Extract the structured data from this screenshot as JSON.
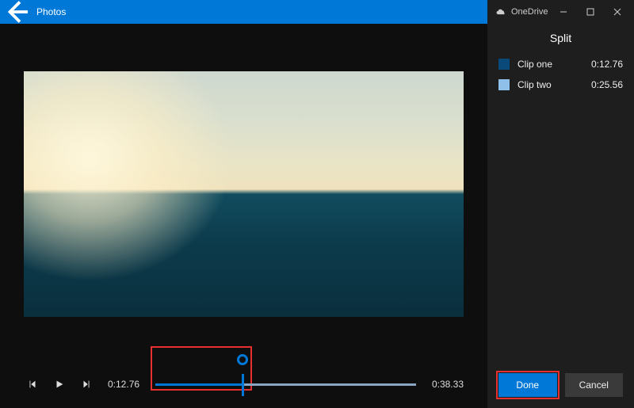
{
  "titlebar": {
    "app_name": "Photos"
  },
  "onedrive": {
    "label": "OneDrive"
  },
  "split_panel": {
    "title": "Split",
    "clips": [
      {
        "label": "Clip one",
        "duration": "0:12.76",
        "swatch_class": "sw1"
      },
      {
        "label": "Clip two",
        "duration": "0:25.56",
        "swatch_class": "sw2"
      }
    ]
  },
  "playback": {
    "current_time": "0:12.76",
    "total_time": "0:38.33",
    "split_fraction": 0.333
  },
  "buttons": {
    "done": "Done",
    "cancel": "Cancel"
  }
}
